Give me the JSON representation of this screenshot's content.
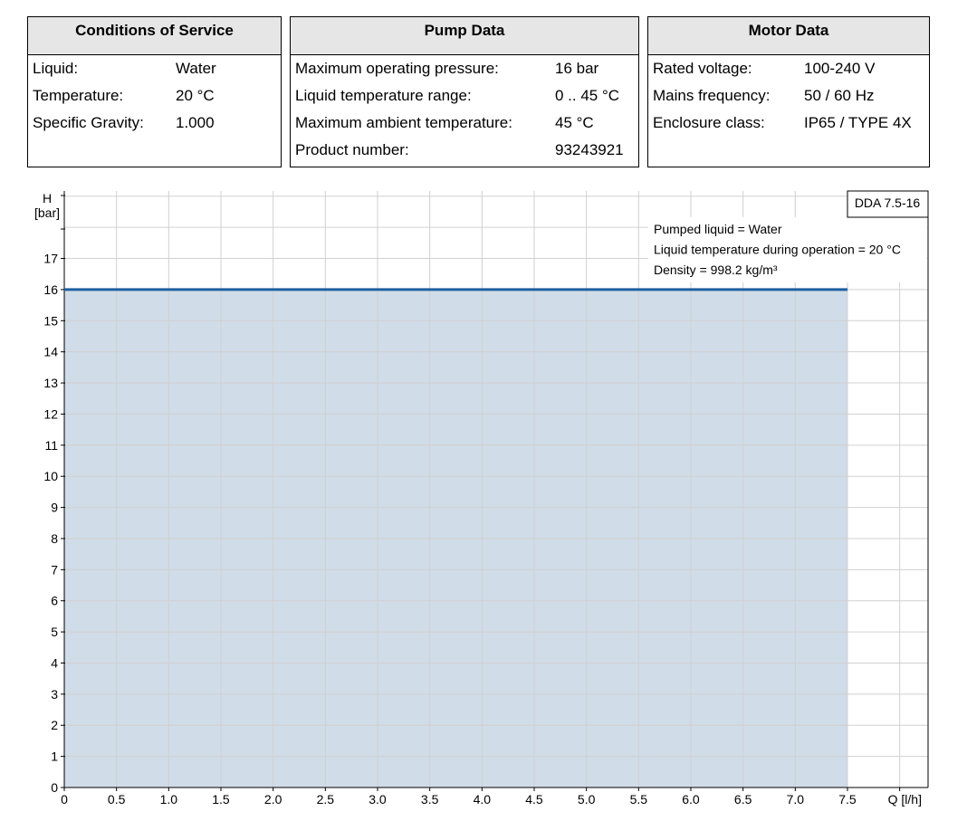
{
  "conditions": {
    "title": "Conditions of Service",
    "rows": [
      {
        "label": "Liquid:",
        "value": "Water"
      },
      {
        "label": "Temperature:",
        "value": "20 °C"
      },
      {
        "label": "Specific Gravity:",
        "value": "1.000"
      }
    ]
  },
  "pump": {
    "title": "Pump Data",
    "rows": [
      {
        "label": "Maximum operating pressure:",
        "value": "16 bar"
      },
      {
        "label": "Liquid temperature range:",
        "value": "0 .. 45 °C"
      },
      {
        "label": "Maximum ambient temperature:",
        "value": "45 °C"
      },
      {
        "label": "Product number:",
        "value": "93243921"
      }
    ]
  },
  "motor": {
    "title": "Motor Data",
    "rows": [
      {
        "label": "Rated voltage:",
        "value": "100-240 V"
      },
      {
        "label": "Mains frequency:",
        "value": "50 / 60 Hz"
      },
      {
        "label": "Enclosure class:",
        "value": "IP65 / TYPE 4X"
      }
    ]
  },
  "chart_data": {
    "type": "area",
    "model_label": "DDA 7.5-16",
    "annotations": [
      "Pumped liquid = Water",
      "Liquid temperature during operation = 20 °C",
      "Density = 998.2 kg/m³"
    ],
    "ylabel_line1": "H",
    "ylabel_line2": "[bar]",
    "xlabel": "Q [l/h]",
    "x_ticks": [
      "0",
      "0.5",
      "1.0",
      "1.5",
      "2.0",
      "2.5",
      "3.0",
      "3.5",
      "4.0",
      "4.5",
      "5.0",
      "5.5",
      "6.0",
      "6.5",
      "7.0",
      "7.5"
    ],
    "y_ticks": [
      "0",
      "1",
      "2",
      "3",
      "4",
      "5",
      "6",
      "7",
      "8",
      "9",
      "10",
      "11",
      "12",
      "13",
      "14",
      "15",
      "16",
      "17"
    ],
    "xlim": [
      0,
      8.25
    ],
    "ylim": [
      0,
      19
    ],
    "series": [
      {
        "x": [
          0,
          7.5
        ],
        "y": [
          16,
          16
        ]
      }
    ],
    "line_color": "#1f5fa0",
    "fill_color": "#d0dce8",
    "grid": true
  }
}
